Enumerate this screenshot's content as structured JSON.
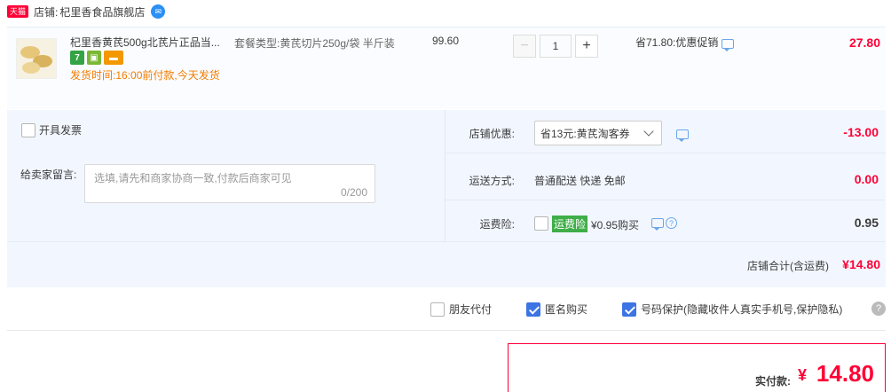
{
  "shop": {
    "badge": "天猫",
    "label": "店铺:",
    "name": "杞里香食品旗舰店"
  },
  "item": {
    "title": "杞里香黄芪500g北芪片正品当...",
    "service_icons": [
      "seven-day-return-icon",
      "phone-verify-icon",
      "credit-card-icon"
    ],
    "ship_time": "发货时间:16:00前付款,今天发货",
    "sku": "套餐类型:黄芪切片250g/袋 半斤装",
    "unit_price": "99.60",
    "quantity": "1",
    "qty_minus": "−",
    "qty_plus": "+",
    "promo": "省71.80:优惠促销",
    "subtotal": "27.80"
  },
  "invoice": {
    "label": "开具发票"
  },
  "message": {
    "label": "给卖家留言:",
    "placeholder": "选填,请先和商家协商一致,付款后商家可见",
    "count": "0/200"
  },
  "shop_discount": {
    "label": "店铺优惠:",
    "selected": "省13元:黄芪淘客券",
    "amount": "-13.00"
  },
  "shipping": {
    "label": "运送方式:",
    "method": "普通配送 快递 免邮",
    "amount": "0.00"
  },
  "shipping_insurance": {
    "label": "运费险:",
    "tag": "运费险",
    "price": "¥0.95购买",
    "amount": "0.95"
  },
  "shop_total": {
    "label": "店铺合计(含运费)",
    "amount": "¥14.80"
  },
  "options": {
    "friend_pay": "朋友代付",
    "anonymous": "匿名购买",
    "number_protect": "号码保护(隐藏收件人真实手机号,保护隐私)"
  },
  "payment": {
    "label": "实付款:",
    "currency": "¥",
    "amount": "14.80"
  },
  "colors": {
    "accent_red": "#ff0036",
    "checkbox_blue": "#3c74e3",
    "panel_bg": "#f2f7ff",
    "ship_orange": "#f27c00"
  }
}
